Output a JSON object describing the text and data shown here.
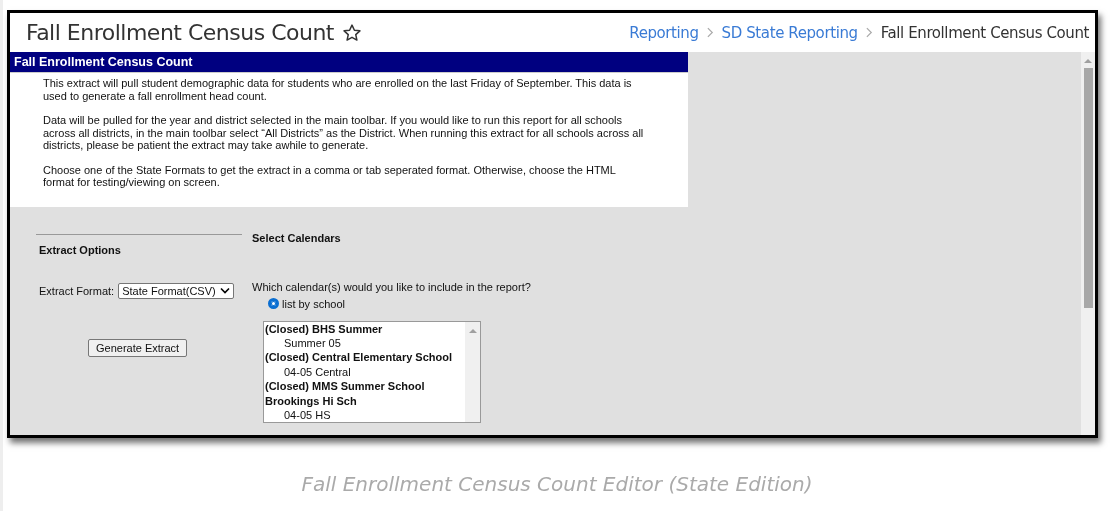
{
  "page_title": "Fall Enrollment Census Count",
  "favorite": {
    "on": false
  },
  "breadcrumb": [
    {
      "label": "Reporting",
      "link": true
    },
    {
      "label": "SD State Reporting",
      "link": true
    },
    {
      "label": "Fall Enrollment Census Count",
      "link": false
    }
  ],
  "panel": {
    "title": "Fall Enrollment Census Count",
    "paragraphs": [
      "This extract will pull student demographic data for students who are enrolled on the last Friday of September. This data is used to generate a fall enrollment head count.",
      "Data will be pulled for the year and district selected in the main toolbar. If you would like to run this report for all schools across all districts, in the main toolbar select “All Districts” as the District. When running this extract for all schools across all districts, please be patient the extract may take awhile to generate.",
      "Choose one of the State Formats to get the extract in a comma or tab seperated format. Otherwise, choose the HTML format for testing/viewing on screen."
    ]
  },
  "extract_options": {
    "heading": "Extract Options",
    "format_label": "Extract Format:",
    "format_value": "State Format(CSV)",
    "button": "Generate Extract"
  },
  "calendars": {
    "heading": "Select Calendars",
    "question": "Which calendar(s) would you like to include in the report?",
    "radio": {
      "label": "list by school",
      "selected": true
    },
    "items": [
      {
        "label": "(Closed) BHS Summer",
        "kind": "school"
      },
      {
        "label": "Summer 05",
        "kind": "calendar"
      },
      {
        "label": "(Closed) Central Elementary School",
        "kind": "school"
      },
      {
        "label": "04-05 Central",
        "kind": "calendar"
      },
      {
        "label": "(Closed) MMS Summer School",
        "kind": "school"
      },
      {
        "label": "Brookings Hi Sch",
        "kind": "school"
      },
      {
        "label": "04-05 HS",
        "kind": "calendar"
      }
    ]
  },
  "caption": "Fall Enrollment Census Count Editor (State Edition)"
}
